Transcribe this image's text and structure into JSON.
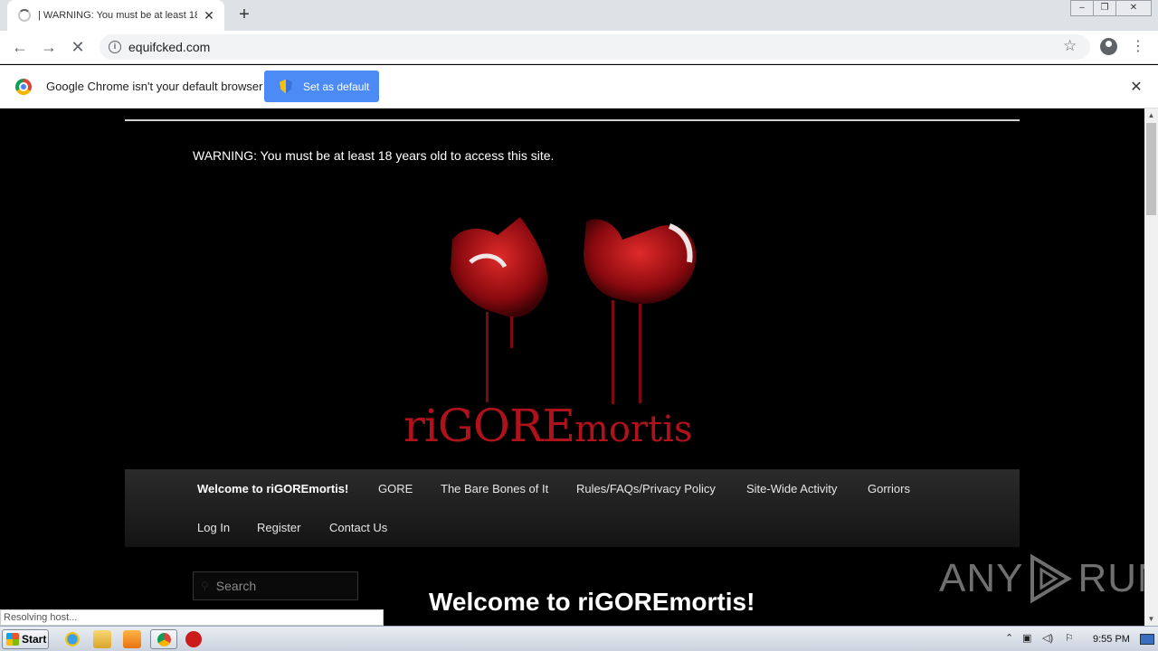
{
  "browser": {
    "tab_title": "| WARNING: You must be at least 18",
    "tab_close": "✕",
    "new_tab": "+",
    "url": "equifcked.com",
    "infobar_text": "Google Chrome isn't your default browser",
    "set_default_label": "Set as default",
    "infobar_close": "✕",
    "status_text": "Resolving host..."
  },
  "page": {
    "warning": "WARNING: You must be at least 18 years old to access this site.",
    "logo": {
      "part1": "riGORE",
      "part2": "mortis"
    },
    "nav": {
      "row1": [
        "Welcome to riGOREmortis!",
        "GORE",
        "The Bare Bones of It",
        "Rules/FAQs/Privacy Policy",
        "Site-Wide Activity",
        "Gorriors"
      ],
      "row2": [
        "Log In",
        "Register",
        "Contact Us"
      ]
    },
    "search_placeholder": "Search",
    "welcome_heading": "Welcome to riGOREmortis!"
  },
  "watermark": {
    "left": "ANY",
    "right": "RUN"
  },
  "taskbar": {
    "start_label": "Start",
    "clock": "9:55 PM"
  },
  "colors": {
    "accent_blue": "#4c8bf5",
    "blood_red": "#b0121b",
    "page_bg": "#000000"
  }
}
